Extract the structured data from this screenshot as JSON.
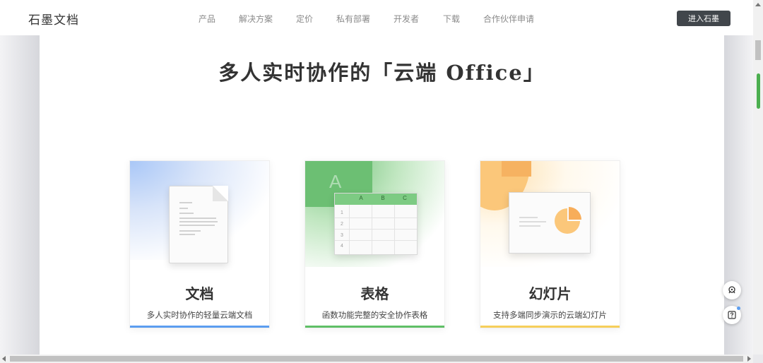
{
  "header": {
    "logo": "石墨文档",
    "nav": [
      "产品",
      "解决方案",
      "定价",
      "私有部署",
      "开发者",
      "下载",
      "合作伙伴申请"
    ],
    "cta_label": "进入石墨"
  },
  "hero": {
    "headline": "多人实时协作的「云端 Office」"
  },
  "cards": [
    {
      "title": "文档",
      "desc": "多人实时协作的轻量云端文档",
      "accent": "#5b9df0"
    },
    {
      "title": "表格",
      "desc": "函数功能完整的安全协作表格",
      "accent": "#5fbf66"
    },
    {
      "title": "幻灯片",
      "desc": "支持多端同步演示的云端幻灯片",
      "accent": "#f6cf5a"
    }
  ],
  "sheet_art": {
    "columns": [
      "A",
      "B",
      "C"
    ],
    "rows": [
      "1",
      "2",
      "3",
      "4"
    ],
    "watermark": "A"
  },
  "floating": {
    "support_icon": "headset-icon",
    "help_icon": "help-icon"
  }
}
